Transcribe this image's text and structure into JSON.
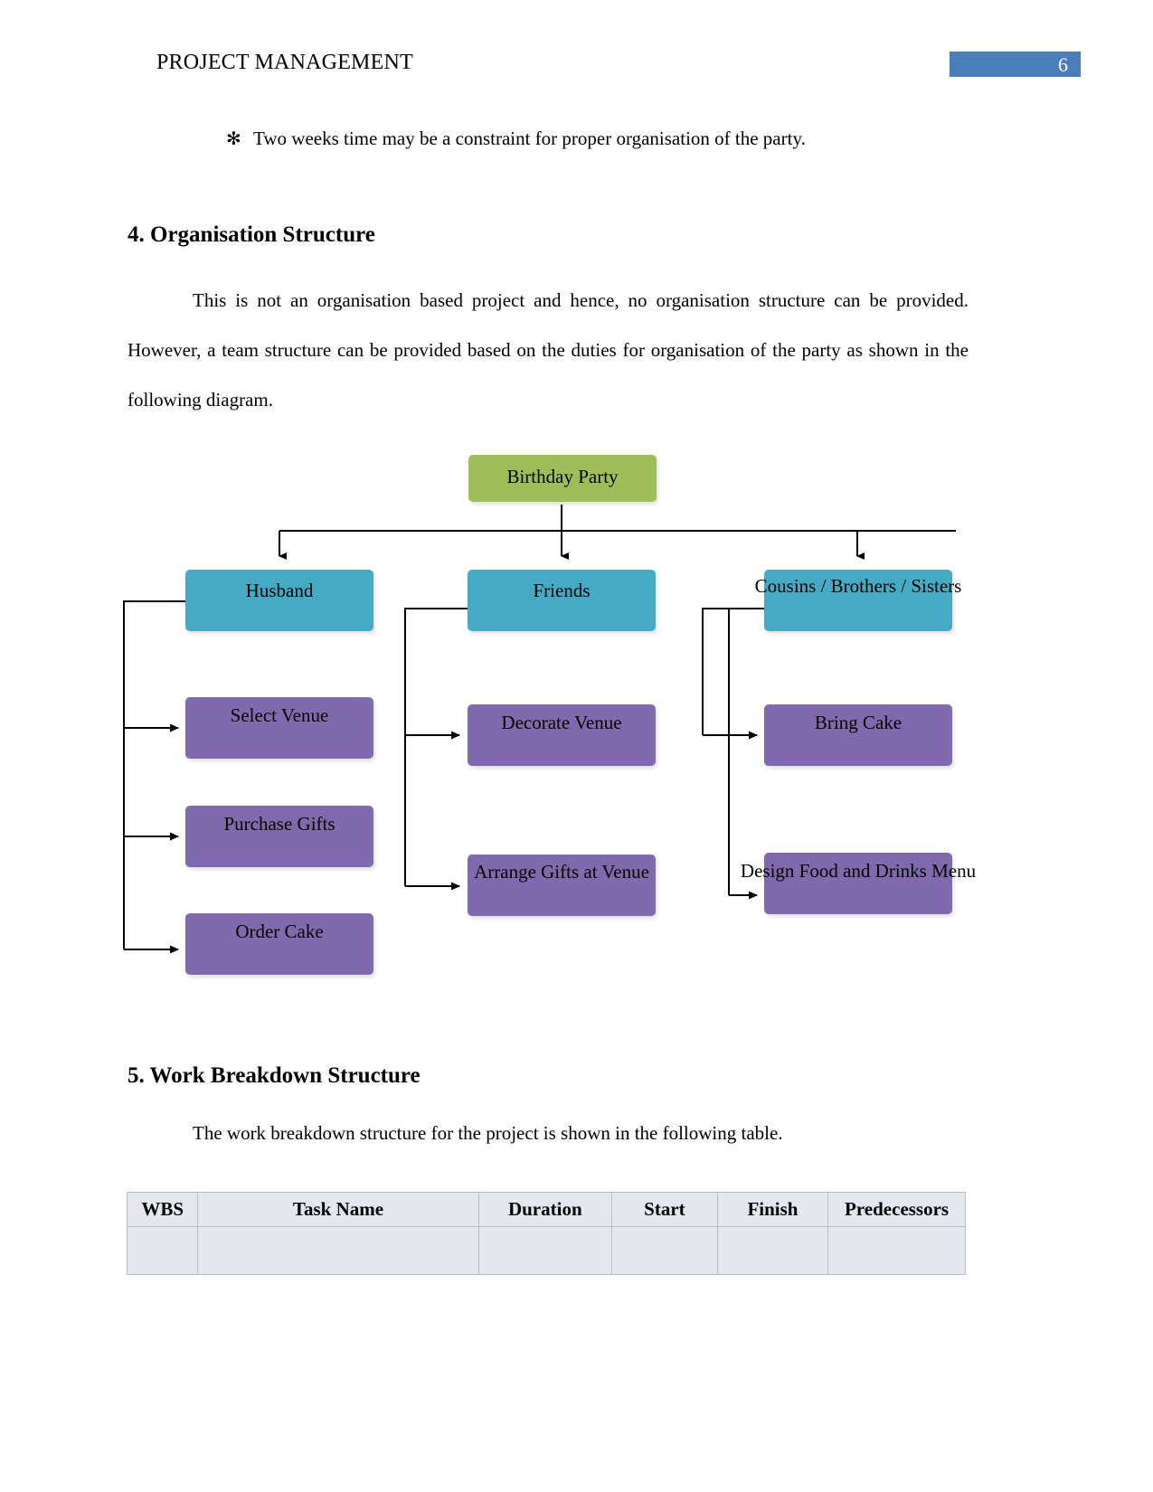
{
  "header": {
    "title": "PROJECT MANAGEMENT",
    "page_number": "6",
    "page_number_color": "#4a7ebb"
  },
  "bullet": {
    "glyph": "✻",
    "text": "Two weeks time may be a constraint for proper organisation of the party."
  },
  "sections": {
    "organisation": {
      "heading": "4. Organisation Structure",
      "paragraph": "This is not an organisation based project and hence, no organisation structure can be provided. However, a team structure can be provided based on the duties for organisation of the party as shown in the following diagram."
    },
    "wbs": {
      "heading": "5. Work Breakdown Structure",
      "paragraph": "The work breakdown structure for the project is shown in the following table."
    }
  },
  "diagram": {
    "colors": {
      "root": "#9ebe5a",
      "team": "#45abc4",
      "task": "#8069ac",
      "connector": "#000000"
    },
    "root": {
      "label": "Birthday Party"
    },
    "teams": [
      {
        "label": "Husband"
      },
      {
        "label": "Friends"
      },
      {
        "label": "Cousins / Brothers / Sisters"
      }
    ],
    "tasks": {
      "husband": [
        {
          "label": "Select Venue"
        },
        {
          "label": "Purchase Gifts"
        },
        {
          "label": "Order Cake"
        }
      ],
      "friends": [
        {
          "label": "Decorate Venue"
        },
        {
          "label": "Arrange Gifts at Venue"
        }
      ],
      "cousins": [
        {
          "label": "Bring Cake"
        },
        {
          "label": "Design Food and Drinks Menu"
        }
      ]
    }
  },
  "table": {
    "columns": [
      "WBS",
      "Task Name",
      "Duration",
      "Start",
      "Finish",
      "Predecessors"
    ],
    "rows": [
      [
        "",
        "",
        "",
        "",
        "",
        ""
      ]
    ]
  }
}
